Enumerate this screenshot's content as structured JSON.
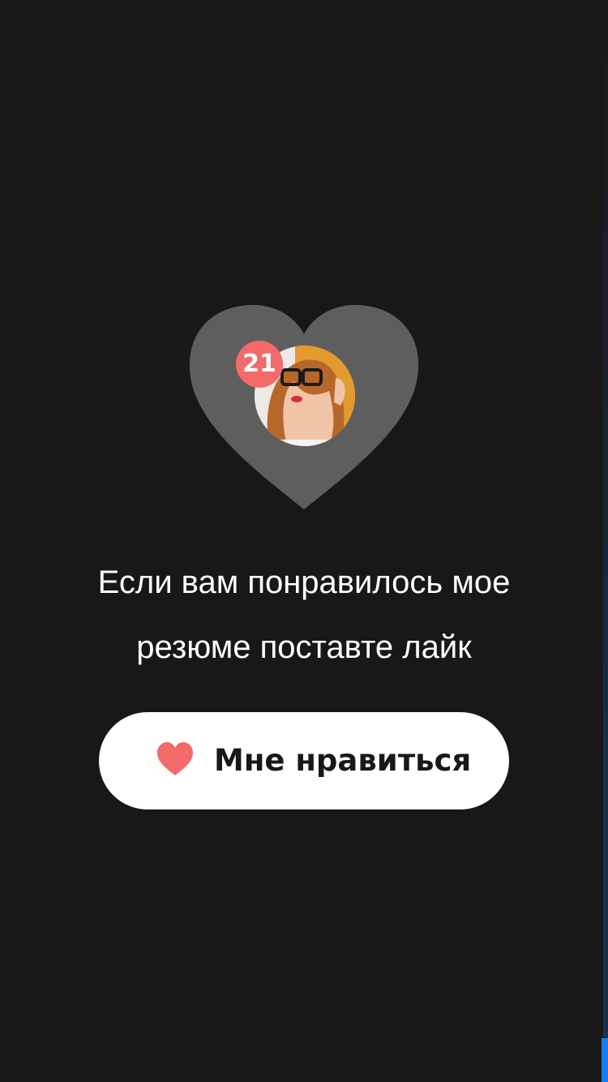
{
  "colors": {
    "background": "#181818",
    "heart_shape": "#5e5e5e",
    "badge_background": "#f36a6a",
    "button_background": "#ffffff",
    "button_heart": "#f36a6a",
    "accent_blue": "#1a7cf3"
  },
  "likes": {
    "count": "21"
  },
  "avatar": {
    "icon": "user-photo"
  },
  "message": {
    "line1": "Если вам понравилось мое",
    "line2": "резюме поставте лайк"
  },
  "like_button": {
    "icon": "heart-icon",
    "label": "Мне нравиться"
  }
}
